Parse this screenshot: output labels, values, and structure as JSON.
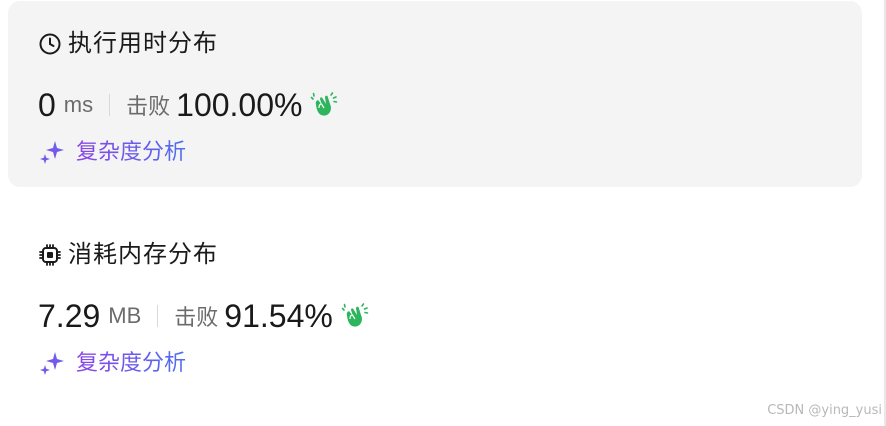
{
  "runtime": {
    "title": "执行用时分布",
    "value": "0",
    "unit": "ms",
    "beat_label": "击败",
    "beat_percent": "100.00%",
    "analysis_label": "复杂度分析",
    "icon": "clock-icon"
  },
  "memory": {
    "title": "消耗内存分布",
    "value": "7.29",
    "unit": "MB",
    "beat_label": "击败",
    "beat_percent": "91.54%",
    "analysis_label": "复杂度分析",
    "icon": "chip-icon"
  },
  "colors": {
    "card_bg": "#f4f4f4",
    "clap_green": "#2db55d",
    "analysis_gradient_start": "#8b45e6",
    "analysis_gradient_end": "#4f6ff0"
  },
  "watermark": "CSDN @ying_yusi"
}
